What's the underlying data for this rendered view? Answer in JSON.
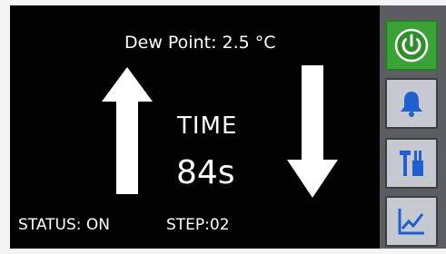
{
  "display": {
    "dew_point": "Dew Point: 2.5 °C",
    "time_label": "TIME",
    "time_value": "84s",
    "status": "STATUS: ON",
    "step": "STEP:02"
  },
  "sidebar": {
    "buttons": [
      {
        "icon": "power-icon",
        "active": true
      },
      {
        "icon": "bell-icon",
        "active": false
      },
      {
        "icon": "tools-icon",
        "active": false
      },
      {
        "icon": "chart-icon",
        "active": false
      }
    ]
  },
  "colors": {
    "screen_bg": "#020202",
    "text": "#ffffff",
    "active_button": "#3aa336",
    "button_bg": "#c6c8cf",
    "icon_blue": "#1f5fd0"
  }
}
